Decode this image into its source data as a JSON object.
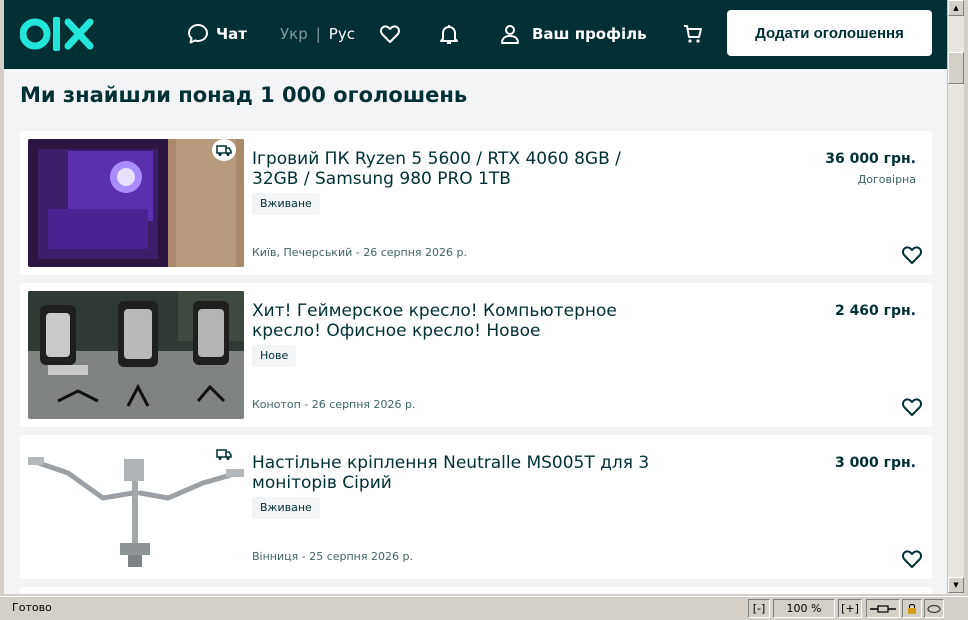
{
  "header": {
    "logo_text": "olx",
    "chat_label": "Чат",
    "lang_uk": "Укр",
    "lang_sep": "|",
    "lang_ru": "Рус",
    "profile_label": "Ваш профіль",
    "add_ad_label": "Додати оголошення"
  },
  "results": {
    "title": "Ми знайшли понад 1 000 оголошень",
    "listings": [
      {
        "title": "Ігровий ПК Ryzen 5 5600 / RTX 4060 8GB / 32GB / Samsung 980 PRO 1TB",
        "condition": "Вживане",
        "location_date": "Київ, Печерський - 26 серпня 2026 р.",
        "price": "36 000 грн.",
        "negotiable": "Договірна",
        "delivery": true
      },
      {
        "title": "Хит! Геймерское кресло! Компьютерное кресло! Офисное кресло! Новое",
        "condition": "Нове",
        "location_date": "Конотоп - 26 серпня 2026 р.",
        "price": "2 460 грн.",
        "negotiable": "",
        "delivery": false
      },
      {
        "title": "Настільне кріплення Neutralle MS005T для 3 моніторів Сірий",
        "condition": "Вживане",
        "location_date": "Вінниця - 25 серпня 2026 р.",
        "price": "3 000 грн.",
        "negotiable": "",
        "delivery": true
      }
    ]
  },
  "statusbar": {
    "status": "Готово",
    "zoom_out": "[-]",
    "zoom": "100 %",
    "zoom_in": "[+]"
  },
  "colors": {
    "brand_dark": "#002f34",
    "brand_accent": "#23e5db",
    "page_bg": "#f2f4f5"
  },
  "icons": [
    "chat-icon",
    "heart-icon",
    "bell-icon",
    "user-icon",
    "cart-icon",
    "delivery-truck-icon",
    "favorite-heart-icon"
  ]
}
